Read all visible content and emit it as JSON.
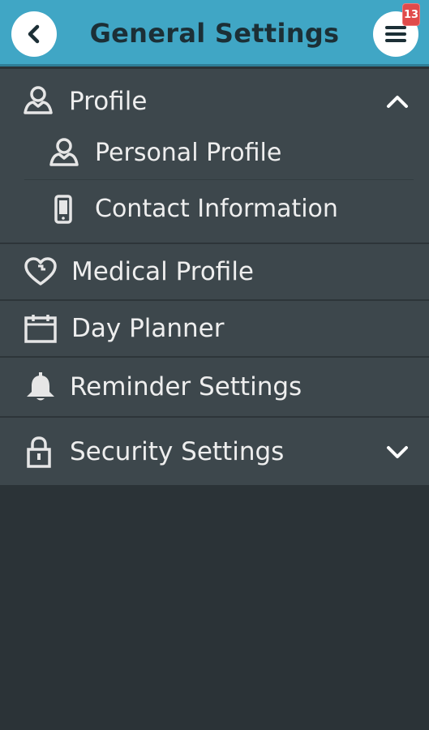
{
  "header": {
    "title": "General Settings",
    "badge_count": "13",
    "back_icon": "chevron-left-icon",
    "menu_icon": "hamburger-menu-icon"
  },
  "menu": {
    "profile": {
      "label": "Profile",
      "icon": "user-icon",
      "expanded": true
    },
    "personal_profile": {
      "label": "Personal Profile",
      "icon": "user-icon"
    },
    "contact_information": {
      "label": "Contact Information",
      "icon": "phone-icon"
    },
    "medical_profile": {
      "label": "Medical Profile",
      "icon": "heart-icon"
    },
    "day_planner": {
      "label": "Day Planner",
      "icon": "calendar-icon"
    },
    "reminder_settings": {
      "label": "Reminder Settings",
      "icon": "bell-icon"
    },
    "security_settings": {
      "label": "Security Settings",
      "icon": "lock-icon",
      "expanded": false
    }
  },
  "colors": {
    "header": "#40a6c5",
    "panel": "#3d474c",
    "background": "#2b3337",
    "badge": "#e04a4a",
    "title_text": "#1c2f36"
  }
}
